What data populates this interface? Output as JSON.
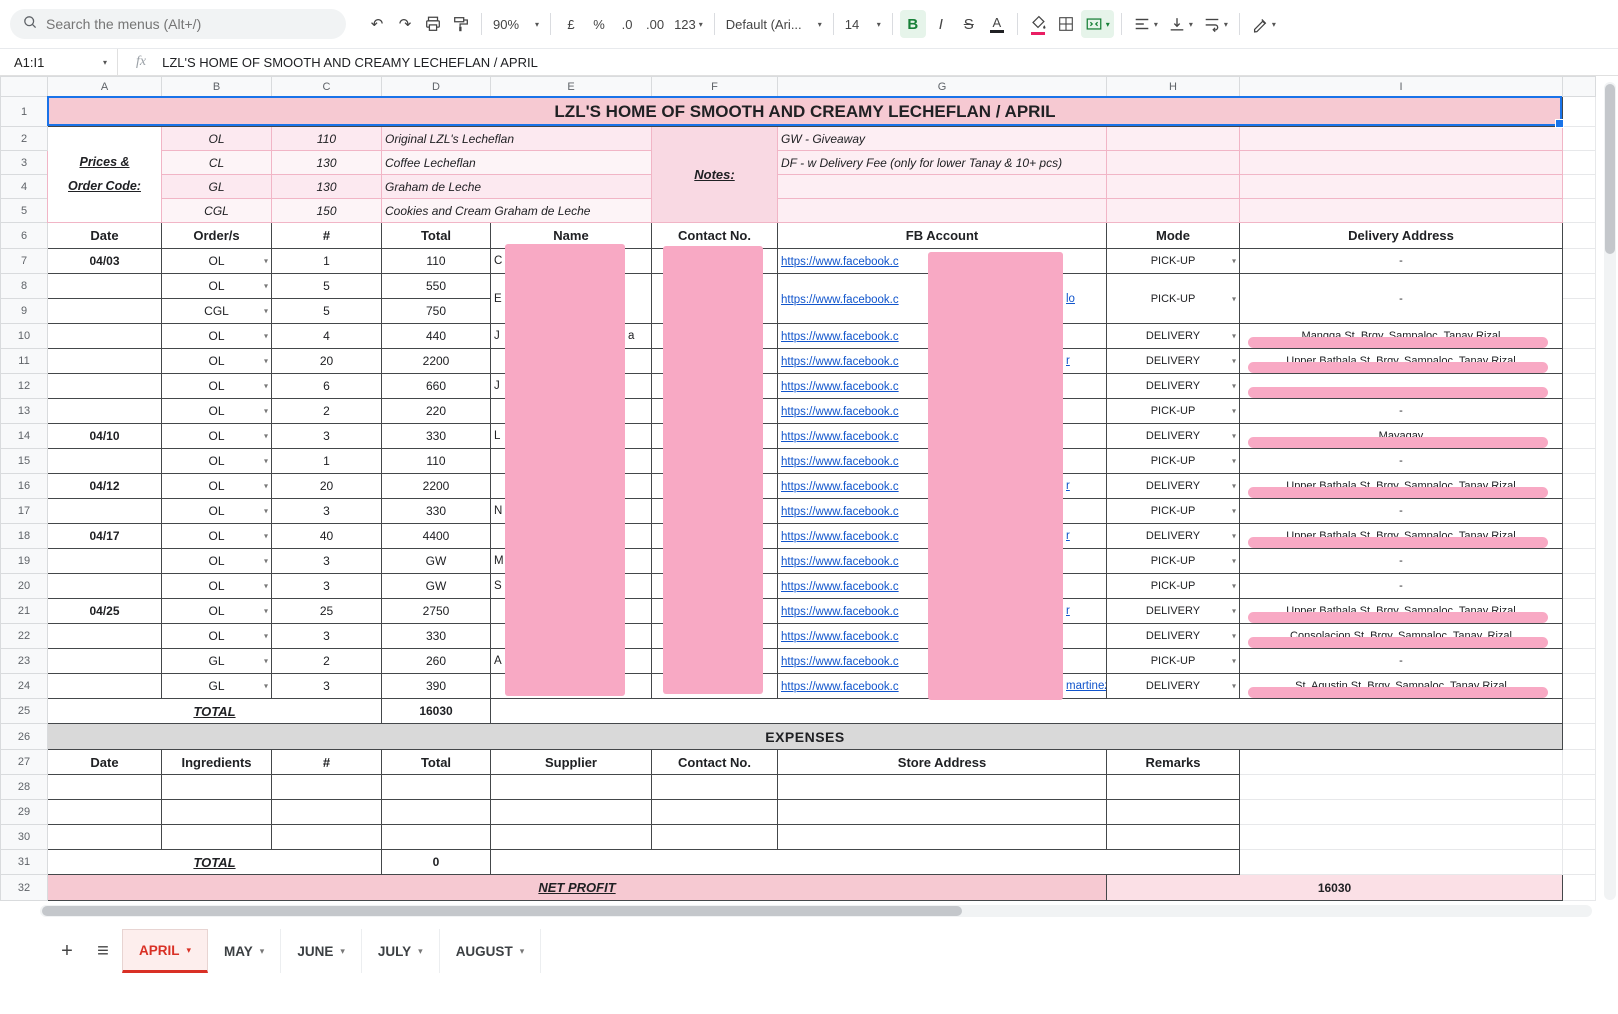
{
  "toolbar": {
    "search_placeholder": "Search the menus (Alt+/)",
    "zoom": "90%",
    "labels": {
      "currency": "£",
      "percent": "%",
      "dec_decrease": ".0",
      "dec_increase": ".00",
      "format": "123",
      "font": "Default (Ari...",
      "font_size": "14",
      "bold": "B",
      "italic": "I",
      "strikethrough": "S",
      "text_color": "A"
    }
  },
  "formula_bar": {
    "cell_reference": "A1:I1",
    "fx_label": "fx",
    "value": "LZL'S HOME OF SMOOTH AND CREAMY LECHEFLAN / APRIL"
  },
  "columns": [
    "A",
    "B",
    "C",
    "D",
    "E",
    "F",
    "G",
    "H",
    "I"
  ],
  "icons": {
    "undo": "↶",
    "redo": "↷",
    "dropdown": "▾",
    "add_sheet": "+",
    "all_sheets": "≡",
    "search": "magnifier-svg",
    "print": "printer-svg",
    "paint_format": "paint-roller-svg",
    "fill_color": "bucket-svg",
    "borders": "grid-svg",
    "merge_cells": "merge-svg",
    "h_align": "align-lines-svg",
    "v_align": "valign-svg",
    "text_wrap": "wrap-svg",
    "text_rotation": "pen-svg"
  },
  "colors": {
    "title_bg": "#f6c9d2",
    "expenses_bg": "#d9d9d9",
    "net_profit_bg": "#f6c9d2",
    "net_profit_value_bg": "#fbe0e6",
    "link": "#1155cc",
    "active_tab": "#d93025",
    "selection": "#1a73e8",
    "redaction": "#f8a9c4",
    "bold_active": "#188038"
  },
  "sheet": {
    "title": "LZL'S HOME OF SMOOTH AND CREAMY LECHEFLAN / APRIL",
    "prices_label_lines": [
      "Prices &",
      "Order Code:"
    ],
    "prices": [
      {
        "code": "OL",
        "price": "110",
        "name": "Original LZL's Lecheflan"
      },
      {
        "code": "CL",
        "price": "130",
        "name": "Coffee Lecheflan"
      },
      {
        "code": "GL",
        "price": "130",
        "name": "Graham de Leche"
      },
      {
        "code": "CGL",
        "price": "150",
        "name": "Cookies and Cream Graham de Leche"
      }
    ],
    "notes_label": "Notes:",
    "notes": [
      "GW - Giveaway",
      "DF - w Delivery Fee (only for lower Tanay & 10+ pcs)"
    ],
    "order_headers": [
      "Date",
      "Order/s",
      "#",
      "Total",
      "Name",
      "Contact No.",
      "FB Account",
      "Mode",
      "Delivery Address"
    ],
    "fb_prefix": "https://www.facebook.c",
    "orders": [
      {
        "date": "04/03",
        "order": "OL",
        "qty": "1",
        "total": "110",
        "name": "C",
        "mode": "PICK-UP",
        "address": "-"
      },
      {
        "date": "",
        "order": "OL",
        "qty": "5",
        "total": "550",
        "name": "E",
        "fb_suffix": "lo",
        "mode": "PICK-UP",
        "address": "-",
        "span": 2
      },
      {
        "date": "",
        "order": "CGL",
        "qty": "5",
        "total": "750",
        "merged": true
      },
      {
        "date": "",
        "order": "OL",
        "qty": "4",
        "total": "440",
        "name": "J",
        "name_suffix": "a",
        "mode": "DELIVERY",
        "address": "Mangga St. Brgy. Sampaloc, Tanay Rizal",
        "redacted": true
      },
      {
        "date": "",
        "order": "OL",
        "qty": "20",
        "total": "2200",
        "fb_suffix": "r",
        "mode": "DELIVERY",
        "address": "Upper Bathala St. Brgy. Sampaloc, Tanay Rizal",
        "redacted": true
      },
      {
        "date": "",
        "order": "OL",
        "qty": "6",
        "total": "660",
        "name": "J",
        "mode": "DELIVERY",
        "address": "",
        "redacted": true
      },
      {
        "date": "",
        "order": "OL",
        "qty": "2",
        "total": "220",
        "mode": "PICK-UP",
        "address": "-"
      },
      {
        "date": "04/10",
        "order": "OL",
        "qty": "3",
        "total": "330",
        "name": "L",
        "mode": "DELIVERY",
        "address": "Mayagay",
        "redacted": true
      },
      {
        "date": "",
        "order": "OL",
        "qty": "1",
        "total": "110",
        "mode": "PICK-UP",
        "address": "-"
      },
      {
        "date": "04/12",
        "order": "OL",
        "qty": "20",
        "total": "2200",
        "fb_suffix": "r",
        "mode": "DELIVERY",
        "address": "Upper Bathala St. Brgy. Sampaloc, Tanay Rizal",
        "redacted": true
      },
      {
        "date": "",
        "order": "OL",
        "qty": "3",
        "total": "330",
        "name": "N",
        "mode": "PICK-UP",
        "address": "-"
      },
      {
        "date": "04/17",
        "order": "OL",
        "qty": "40",
        "total": "4400",
        "fb_suffix": "r",
        "mode": "DELIVERY",
        "address": "Upper Bathala St. Brgy. Sampaloc, Tanay Rizal",
        "redacted": true
      },
      {
        "date": "",
        "order": "OL",
        "qty": "3",
        "total": "GW",
        "name": "M",
        "mode": "PICK-UP",
        "address": "-"
      },
      {
        "date": "",
        "order": "OL",
        "qty": "3",
        "total": "GW",
        "name": "S",
        "mode": "PICK-UP",
        "address": "-"
      },
      {
        "date": "04/25",
        "order": "OL",
        "qty": "25",
        "total": "2750",
        "fb_suffix": "r",
        "mode": "DELIVERY",
        "address": "Upper Bathala St. Brgy. Sampaloc, Tanay Rizal",
        "redacted": true
      },
      {
        "date": "",
        "order": "OL",
        "qty": "3",
        "total": "330",
        "mode": "DELIVERY",
        "address": "Consolacion St. Brgy. Sampaloc, Tanay, Rizal",
        "redacted": true
      },
      {
        "date": "",
        "order": "GL",
        "qty": "2",
        "total": "260",
        "name": "A",
        "mode": "PICK-UP",
        "address": "-"
      },
      {
        "date": "",
        "order": "GL",
        "qty": "3",
        "total": "390",
        "fb_suffix": "martinez.",
        "mode": "DELIVERY",
        "address": "St. Agustin St. Brgy. Sampaloc, Tanay Rizal",
        "redacted": true
      }
    ],
    "total_label": "TOTAL",
    "total_value": "16030",
    "expenses_title": "EXPENSES",
    "expense_headers": [
      "Date",
      "Ingredients",
      "#",
      "Total",
      "Supplier",
      "Contact No.",
      "Store Address",
      "Remarks"
    ],
    "expenses_total_label": "TOTAL",
    "expenses_total_value": "0",
    "net_profit_label": "NET PROFIT",
    "net_profit_value": "16030",
    "redaction_boxes": [
      "name-column",
      "contact-number-column",
      "fb-account-column"
    ]
  },
  "tabs": {
    "active": "APRIL",
    "items": [
      {
        "label": "APRIL",
        "active": true
      },
      {
        "label": "MAY"
      },
      {
        "label": "JUNE"
      },
      {
        "label": "JULY"
      },
      {
        "label": "AUGUST"
      }
    ]
  }
}
